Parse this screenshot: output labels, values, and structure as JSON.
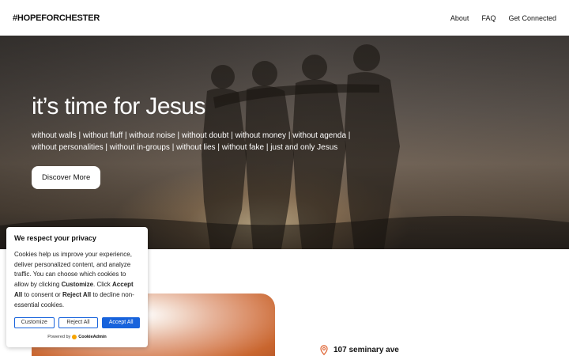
{
  "header": {
    "logo": "#HOPEFORCHESTER",
    "nav": [
      {
        "label": "About"
      },
      {
        "label": "FAQ"
      },
      {
        "label": "Get Connected"
      }
    ]
  },
  "hero": {
    "title": "it’s time for Jesus",
    "subtitle_line1": "without walls | without fluff | without noise | without doubt | without money | without agenda |",
    "subtitle_line2": "without personalities | without in-groups | without lies | without fake | just and only Jesus",
    "cta_label": "Discover More"
  },
  "location": {
    "address": "107 seminary ave"
  },
  "cookie_banner": {
    "title": "We respect your privacy",
    "text_1": "Cookies help us improve your experience, deliver personalized content, and analyze traffic. You can choose which cookies to allow by clicking ",
    "bold_1": "Customize",
    "text_2": ". Click ",
    "bold_2": "Accept All",
    "text_3": " to consent or ",
    "bold_3": "Reject All",
    "text_4": " to decline non-essential cookies.",
    "customize_label": "Customize",
    "reject_label": "Reject All",
    "accept_label": "Accept All",
    "powered_by": "Powered by",
    "brand": "CookieAdmin"
  },
  "colors": {
    "accent": "#1863dc",
    "text": "#111111",
    "hero_overlay": "#3d352f"
  }
}
